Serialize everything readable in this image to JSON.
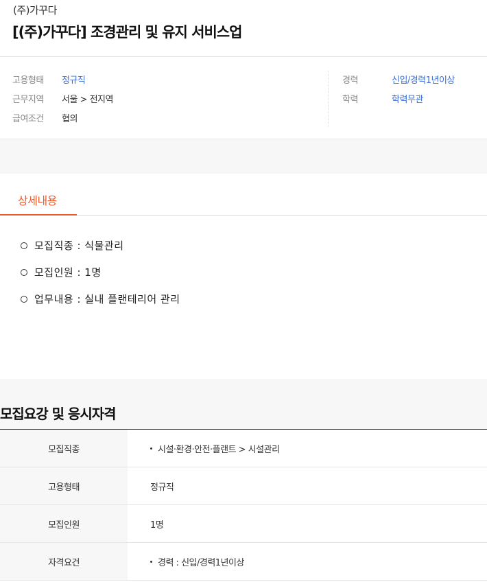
{
  "header": {
    "company": "(주)가꾸다",
    "title": "[(주)가꾸다] 조경관리 및 유지 서비스업"
  },
  "summary": {
    "left": [
      {
        "label": "고용형태",
        "value": "정규직",
        "link": true
      },
      {
        "label": "근무지역",
        "value": "서울 > 전지역",
        "link": false
      },
      {
        "label": "급여조건",
        "value": "협의",
        "link": false
      }
    ],
    "right": [
      {
        "label": "경력",
        "value": "신입/경력1년이상",
        "link": true
      },
      {
        "label": "학력",
        "value": "학력무관",
        "link": true
      }
    ]
  },
  "tabs": {
    "active_label": "상세내용"
  },
  "detail": {
    "lines": [
      "모집직종 : 식물관리",
      "모집인원 : 1명",
      "업무내용 : 실내 플랜테리어 관리"
    ]
  },
  "requirements": {
    "title": "모집요강 및 응시자격",
    "rows": [
      {
        "label": "모집직종",
        "value": "시설·환경·안전·플랜트 > 시설관리",
        "bullet": true
      },
      {
        "label": "고용형태",
        "value": "정규직",
        "bullet": false
      },
      {
        "label": "모집인원",
        "value": "1명",
        "bullet": false
      },
      {
        "label": "자격요건",
        "value": "경력 : 신입/경력1년이상",
        "bullet": true
      }
    ]
  },
  "colors": {
    "accent": "#f05a28",
    "link": "#3b6fd4"
  }
}
